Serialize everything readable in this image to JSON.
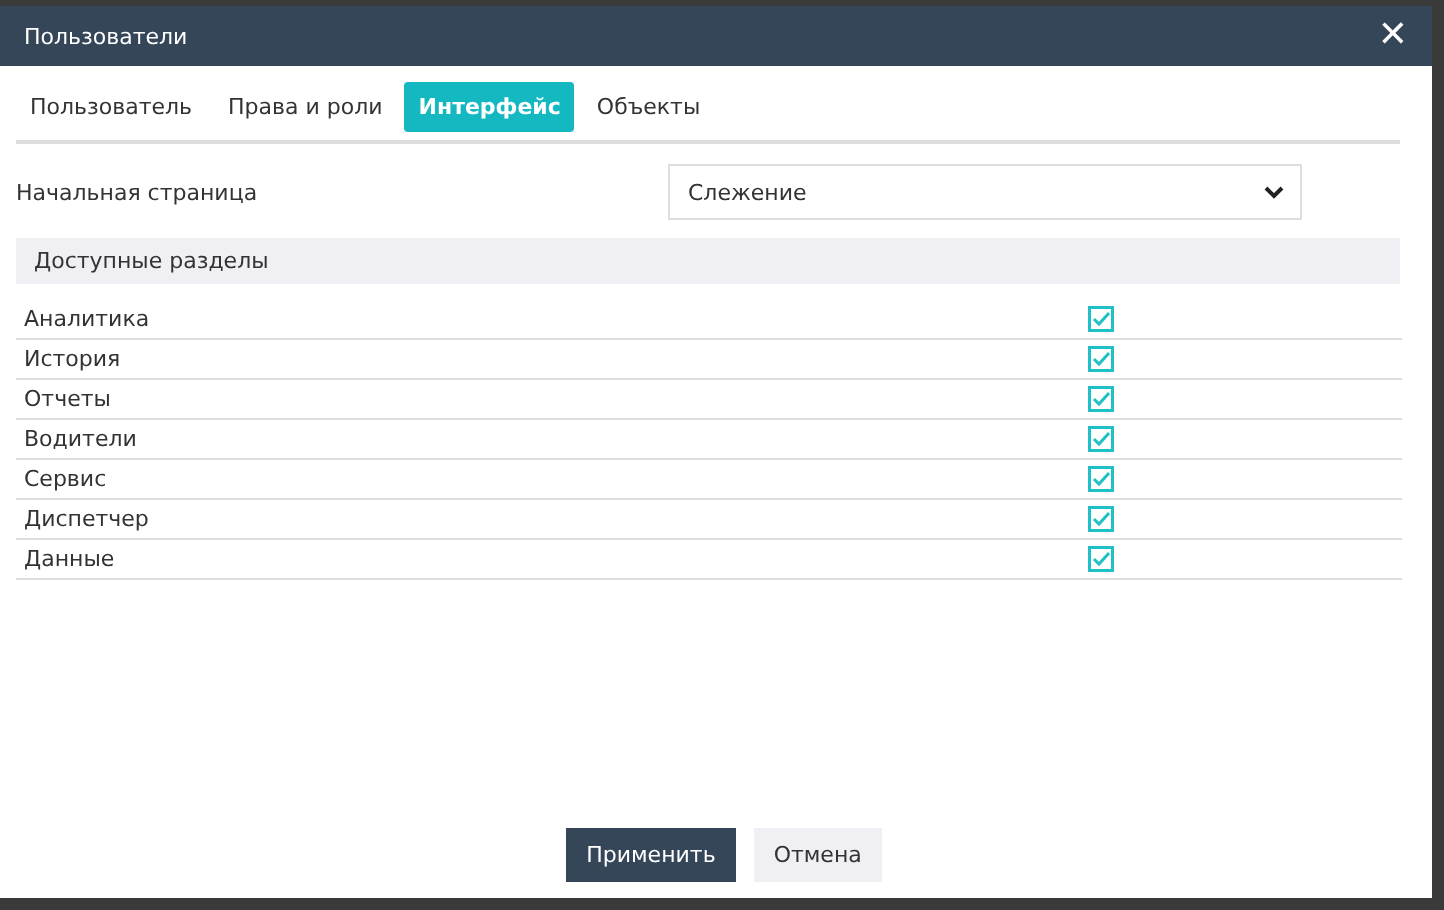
{
  "window": {
    "title": "Пользователи",
    "close": "✕"
  },
  "tabs": [
    {
      "label": "Пользователь",
      "selected": false
    },
    {
      "label": "Права и роли",
      "selected": false
    },
    {
      "label": "Интерфейс",
      "selected": true
    },
    {
      "label": "Объекты",
      "selected": false
    }
  ],
  "start_page": {
    "label": "Начальная страница",
    "value": "Слежение"
  },
  "sections": {
    "title": "Доступные разделы",
    "items": [
      {
        "label": "Аналитика",
        "checked": true
      },
      {
        "label": "История",
        "checked": true
      },
      {
        "label": "Отчеты",
        "checked": true
      },
      {
        "label": "Водители",
        "checked": true
      },
      {
        "label": "Сервис",
        "checked": true
      },
      {
        "label": "Диспетчер",
        "checked": true
      },
      {
        "label": "Данные",
        "checked": true
      }
    ]
  },
  "buttons": [
    {
      "label": "Применить",
      "kind": "primary"
    },
    {
      "label": "Отмена",
      "kind": "secondary"
    }
  ]
}
